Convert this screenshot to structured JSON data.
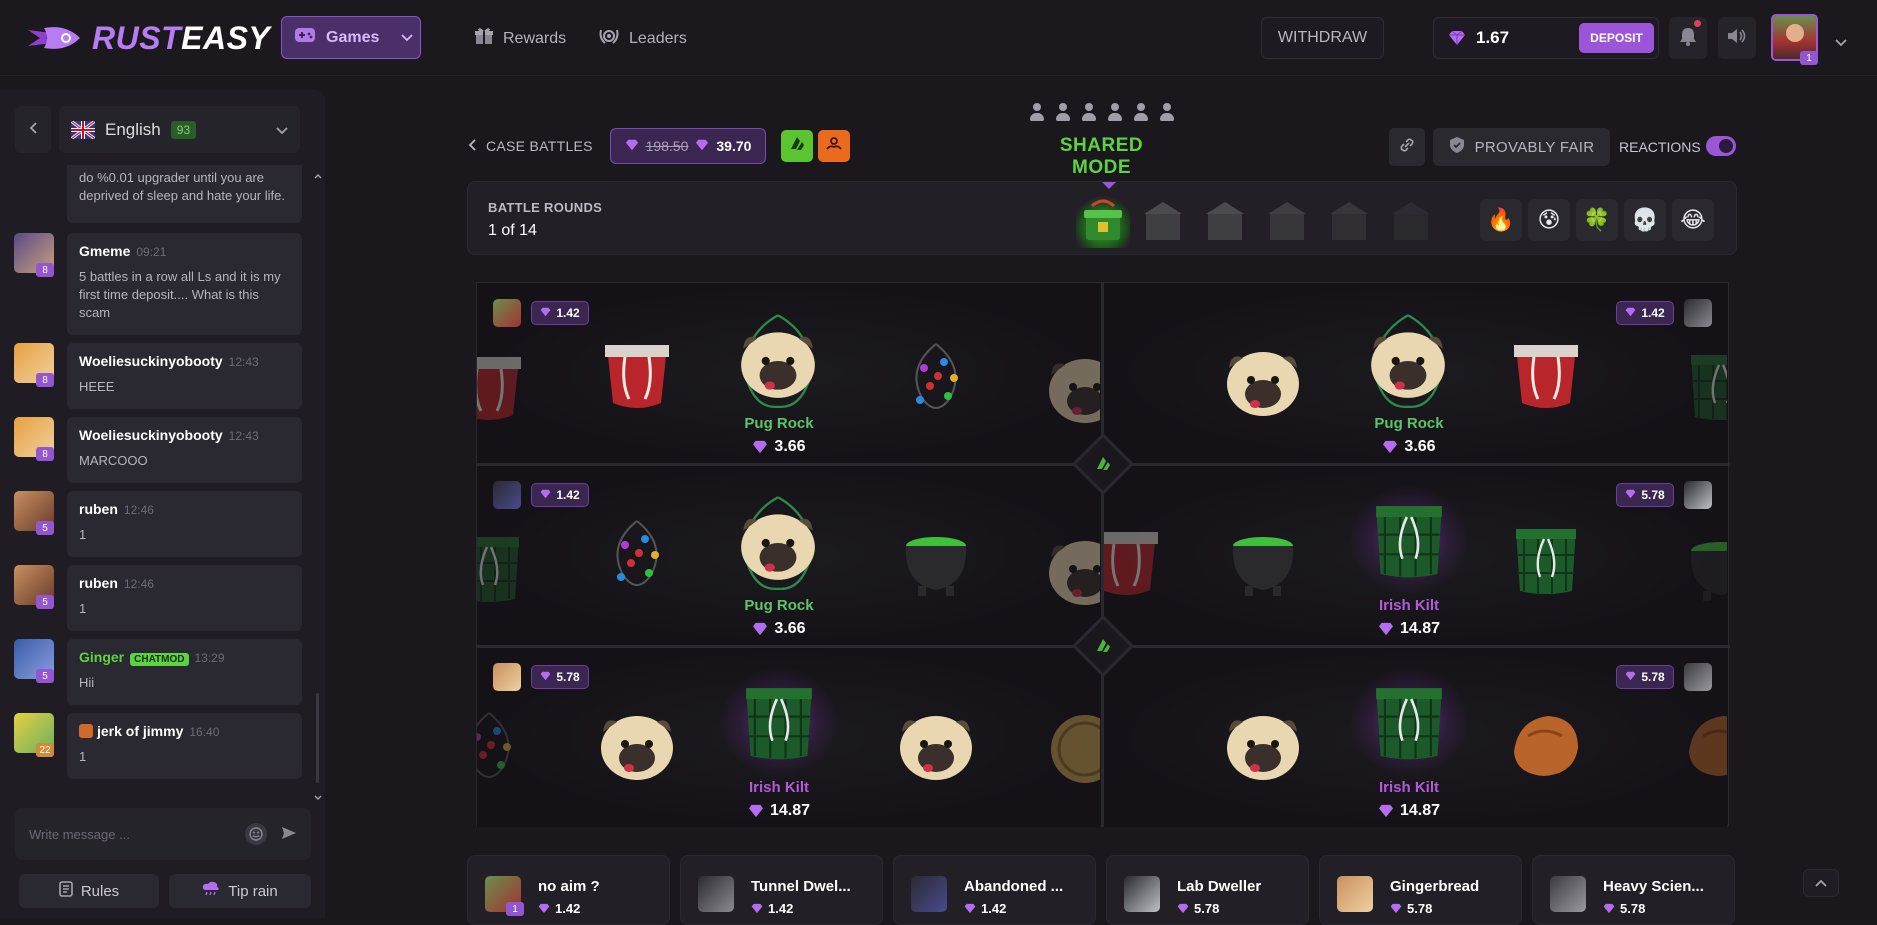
{
  "brand": {
    "part1": "RUST",
    "part2": "EASY"
  },
  "header": {
    "games_label": "Games",
    "rewards_label": "Rewards",
    "leaders_label": "Leaders",
    "withdraw_label": "WITHDRAW",
    "balance": "1.67",
    "deposit_label": "DEPOSIT",
    "user_level": "1"
  },
  "sidebar": {
    "language": "English",
    "online_count": "93",
    "messages": [
      {
        "name": "",
        "time": "",
        "text": "do %0.01 upgrader until you are deprived of sleep and hate your life.",
        "level": ""
      },
      {
        "name": "Gmeme",
        "time": "09:21",
        "text": "5 battles in a row all Ls and it is my first time deposit.... What is this scam",
        "level": "8"
      },
      {
        "name": "Woeliesuckinyobooty",
        "time": "12:43",
        "text": "HEEE",
        "level": "8"
      },
      {
        "name": "Woeliesuckinyobooty",
        "time": "12:43",
        "text": "MARCOOO",
        "level": "8"
      },
      {
        "name": "ruben",
        "time": "12:46",
        "text": "1",
        "level": "5"
      },
      {
        "name": "ruben",
        "time": "12:46",
        "text": "1",
        "level": "5"
      },
      {
        "name": "Ginger",
        "badge": "CHATMOD",
        "time": "13:29",
        "text": "Hii",
        "level": "5"
      },
      {
        "name": "jerk of jimmy",
        "time": "16:40",
        "text": "1",
        "level": "22"
      }
    ],
    "input_placeholder": "Write message ...",
    "rules_label": "Rules",
    "tip_rain_label": "Tip rain"
  },
  "battle": {
    "back_label": "CASE BATTLES",
    "old_price": "198.50",
    "price": "39.70",
    "mode": "SHARED MODE",
    "provably_fair_label": "PROVABLY FAIR",
    "reactions_label": "REACTIONS",
    "rounds_label": "BATTLE ROUNDS",
    "rounds_value": "1 of 14",
    "reactions": [
      "🔥",
      "😰",
      "🍀",
      "💀",
      "😂"
    ],
    "lanes": [
      {
        "value": "1.42",
        "item": "Pug Rock",
        "price": "3.66",
        "color": "#5ec46a"
      },
      {
        "value": "1.42",
        "item": "Pug Rock",
        "price": "3.66",
        "color": "#5ec46a"
      },
      {
        "value": "1.42",
        "item": "Pug Rock",
        "price": "3.66",
        "color": "#5ec46a"
      },
      {
        "value": "5.78",
        "item": "Irish Kilt",
        "price": "14.87",
        "color": "#b45ad8"
      },
      {
        "value": "5.78",
        "item": "Irish Kilt",
        "price": "14.87",
        "color": "#b45ad8"
      },
      {
        "value": "5.78",
        "item": "Irish Kilt",
        "price": "14.87",
        "color": "#b45ad8"
      }
    ]
  },
  "players": [
    {
      "name": "no aim ?",
      "value": "1.42",
      "level": "1"
    },
    {
      "name": "Tunnel Dwel...",
      "value": "1.42"
    },
    {
      "name": "Abandoned ...",
      "value": "1.42"
    },
    {
      "name": "Lab Dweller",
      "value": "5.78"
    },
    {
      "name": "Gingerbread",
      "value": "5.78"
    },
    {
      "name": "Heavy Scien...",
      "value": "5.78"
    }
  ],
  "colors": {
    "accent": "#9c55d8",
    "green": "#5cd33f",
    "background": "#1a181d"
  }
}
